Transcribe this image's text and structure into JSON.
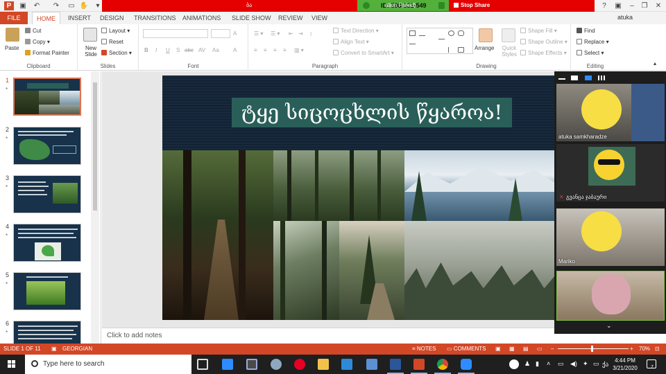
{
  "share_banner": {
    "left_text": "ბა",
    "meeting_id": "ID: 598-631-549",
    "stop_share": "Stop Share",
    "right_text": "ation Failed)"
  },
  "tabs": [
    "FILE",
    "HOME",
    "INSERT",
    "DESIGN",
    "TRANSITIONS",
    "ANIMATIONS",
    "SLIDE SHOW",
    "REVIEW",
    "VIEW"
  ],
  "user": {
    "name": "atuka"
  },
  "ribbon": {
    "clipboard": {
      "paste": "Paste",
      "cut": "Cut",
      "copy": "Copy",
      "format_painter": "Format Painter",
      "label": "Clipboard"
    },
    "slides": {
      "new_slide": "New Slide",
      "layout": "Layout",
      "reset": "Reset",
      "section": "Section",
      "label": "Slides"
    },
    "font": {
      "label": "Font",
      "buttons": [
        "B",
        "I",
        "U",
        "S",
        "abc",
        "AV",
        "Aa",
        "A"
      ]
    },
    "paragraph": {
      "label": "Paragraph",
      "text_direction": "Text Direction",
      "align_text": "Align Text",
      "convert": "Convert to SmartArt"
    },
    "drawing": {
      "arrange": "Arrange",
      "quick_styles": "Quick Styles",
      "shape_fill": "Shape Fill",
      "shape_outline": "Shape Outline",
      "shape_effects": "Shape Effects",
      "label": "Drawing"
    },
    "editing": {
      "find": "Find",
      "replace": "Replace",
      "select": "Select",
      "label": "Editing"
    }
  },
  "thumbnails": [
    {
      "num": "1",
      "star": "*"
    },
    {
      "num": "2",
      "star": "*"
    },
    {
      "num": "3",
      "star": "*"
    },
    {
      "num": "4",
      "star": "*"
    },
    {
      "num": "5",
      "star": "*"
    },
    {
      "num": "6",
      "star": "*"
    }
  ],
  "slide": {
    "title": "ტყე სიცოცხლის წყაროა!"
  },
  "notes": {
    "placeholder": "Click to add notes"
  },
  "participants": [
    {
      "name": "atuka samkharadze"
    },
    {
      "name": "გვანცა ჯაბაური"
    },
    {
      "name": "Mariko"
    },
    {
      "name": ""
    }
  ],
  "statusbar": {
    "slide_info": "SLIDE 1 OF 11",
    "language": "GEORGIAN",
    "notes": "NOTES",
    "comments": "COMMENTS",
    "zoom": "70%"
  },
  "taskbar": {
    "search_placeholder": "Type here to search",
    "time": "4:44 PM",
    "date": "3/21/2020",
    "lang": "ქა",
    "notification_count": "7"
  },
  "colors": {
    "accent": "#d24726",
    "banner": "#e50000",
    "share_green": "#53b03b",
    "slide_bg": "#0f1c2b",
    "title_box": "#2a5f59"
  }
}
